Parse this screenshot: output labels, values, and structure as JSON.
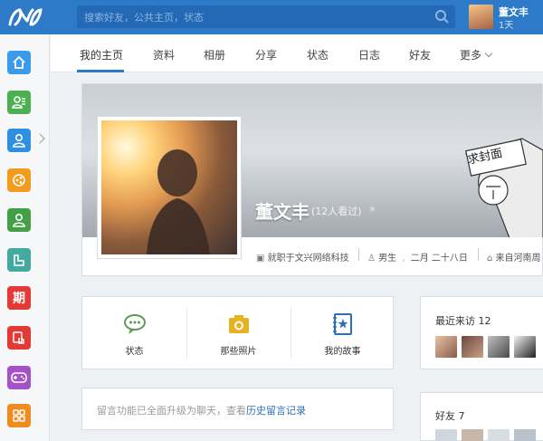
{
  "topbar": {
    "search_placeholder": "搜索好友，公共主页，状态",
    "user_name": "董文丰",
    "user_sub": "1天"
  },
  "sidebar": {
    "items": [
      {
        "icon": "home-icon",
        "color": "#3b9be8"
      },
      {
        "icon": "profile-icon",
        "color": "#4caf50"
      },
      {
        "icon": "friends-icon",
        "color": "#2f8fe0"
      },
      {
        "icon": "share-icon",
        "color": "#f29b1d"
      },
      {
        "icon": "user-icon",
        "color": "#43a047"
      },
      {
        "icon": "app-icon",
        "color": "#44a9a0"
      },
      {
        "icon": "period-icon",
        "color": "#e53935",
        "glyph": "期"
      },
      {
        "icon": "touch-icon",
        "color": "#e53935"
      },
      {
        "icon": "game-icon",
        "color": "#a352c7"
      },
      {
        "icon": "apps-grid-icon",
        "color": "#f08c1e"
      }
    ]
  },
  "nav": {
    "tabs": [
      "我的主页",
      "资料",
      "相册",
      "分享",
      "状态",
      "日志",
      "好友",
      "更多"
    ],
    "active": "我的主页"
  },
  "profile": {
    "name": "董文丰",
    "visited": "(12人看过)",
    "work": "就职于文兴网络科技",
    "gender": "男生",
    "birthday": "二月 二十八日",
    "hometown": "来自河南周",
    "sticker_text": "求封面"
  },
  "actions": [
    {
      "label": "状态",
      "icon": "status-bubble-icon",
      "color": "#5a9a5a"
    },
    {
      "label": "那些照片",
      "icon": "camera-icon",
      "color": "#e8b11e"
    },
    {
      "label": "我的故事",
      "icon": "story-book-icon",
      "color": "#2d6fb6"
    }
  ],
  "message": {
    "text": "留言功能已全面升级为聊天，查看",
    "link": "历史留言记录"
  },
  "recent_visitors": {
    "title": "最近来访",
    "count": "12"
  },
  "friends": {
    "title": "好友",
    "count": "7"
  }
}
